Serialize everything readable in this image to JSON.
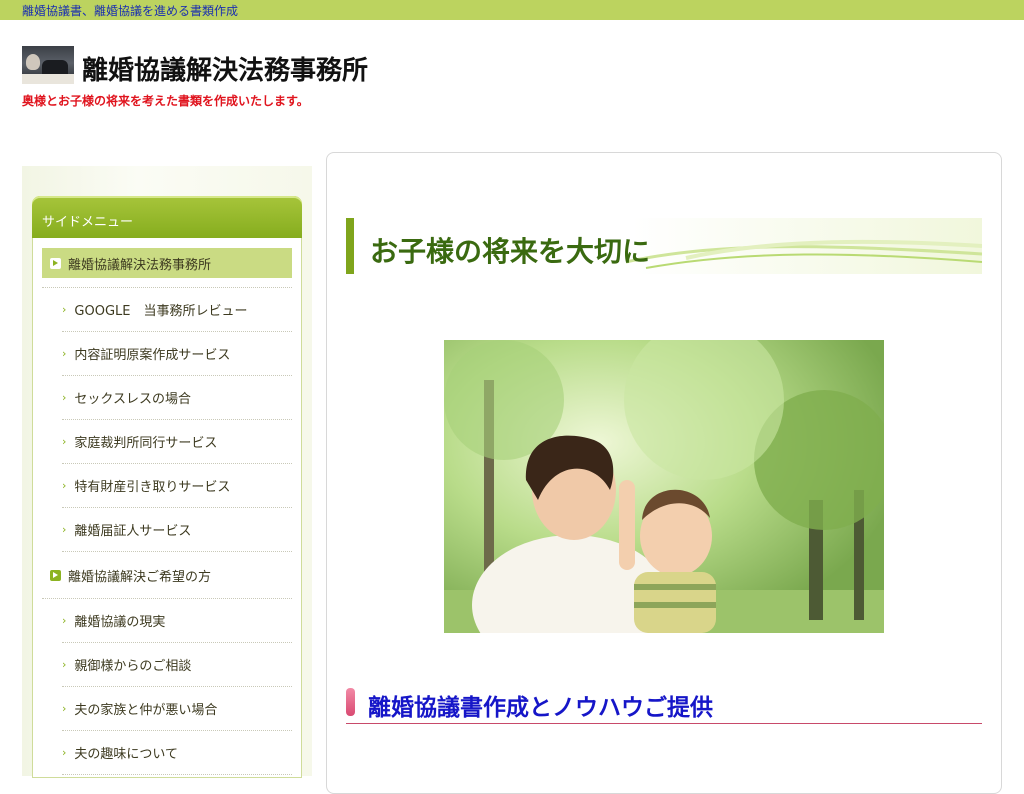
{
  "topbar": {
    "text": "離婚協議書、離婚協議を進める書類作成"
  },
  "header": {
    "site_title": "離婚協議解決法務事務所",
    "tagline": "奥様とお子様の将来を考えた書類を作成いたします。"
  },
  "sidebar": {
    "header": "サイドメニュー",
    "items": [
      {
        "label": "離婚協議解決法務事務所",
        "level": "top",
        "active": true
      },
      {
        "label": "GOOGLE　当事務所レビュー",
        "level": "sub"
      },
      {
        "label": "内容証明原案作成サービス",
        "level": "sub"
      },
      {
        "label": "セックスレスの場合",
        "level": "sub"
      },
      {
        "label": "家庭裁判所同行サービス",
        "level": "sub"
      },
      {
        "label": "特有財産引き取りサービス",
        "level": "sub"
      },
      {
        "label": "離婚届証人サービス",
        "level": "sub"
      },
      {
        "label": "離婚協議解決ご希望の方",
        "level": "top"
      },
      {
        "label": "離婚協議の現実",
        "level": "sub"
      },
      {
        "label": "親御様からのご相談",
        "level": "sub"
      },
      {
        "label": "夫の家族と仲が悪い場合",
        "level": "sub"
      },
      {
        "label": "夫の趣味について",
        "level": "sub"
      }
    ]
  },
  "main": {
    "heading1": "お子様の将来を大切に",
    "heading2": "離婚協議書作成とノウハウご提供"
  },
  "colors": {
    "topbar": "#bcd35f",
    "accent_green": "#86ad1e",
    "heading_green": "#3a6a10",
    "tagline_red": "#e0141e",
    "heading2_blue": "#1616c8",
    "heading2_pink": "#d94a72"
  }
}
